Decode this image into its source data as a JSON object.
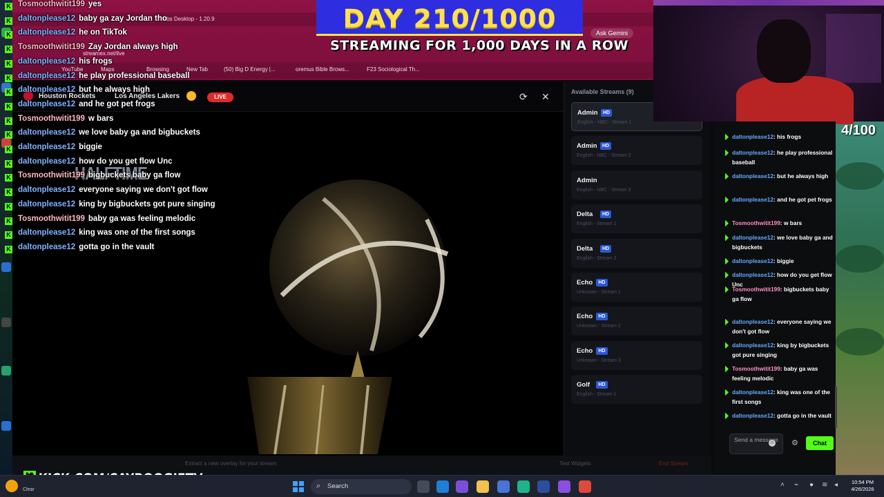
{
  "browser": {
    "app_title": "labs Desktop - 1.20.9",
    "address": "streamex.net/live",
    "ask_gemini": "Ask Gemini",
    "bookmarks": [
      "YouTube",
      "Maps",
      "Browsing",
      "New Tab",
      "(50) Big D Energy |...",
      "oremus Bible Brows...",
      "F23 Sociological Th..."
    ]
  },
  "banner": {
    "day": "DAY 210/1000",
    "subtitle": "STREAMING FOR 1,000 DAYS IN A ROW"
  },
  "counter": "4/100",
  "player": {
    "home_team": "Houston Rockets",
    "away_team": "Los Angeles Lakers",
    "live": "LIVE",
    "refresh_icon": "refresh-icon",
    "close_icon": "close-icon",
    "halftime": "HALFTIME"
  },
  "overlay_chat": [
    {
      "user": "Tosmoothwitit199",
      "msg": "yes",
      "type": "t"
    },
    {
      "user": "daltonplease12",
      "msg": "baby ga zay Jordan tho",
      "type": "d"
    },
    {
      "user": "daltonplease12",
      "msg": "he on TikTok",
      "type": "d"
    },
    {
      "user": "Tosmoothwitit199",
      "msg": "Zay Jordan always high",
      "type": "t"
    },
    {
      "user": "daltonplease12",
      "msg": "his frogs",
      "type": "d"
    },
    {
      "user": "daltonplease12",
      "msg": "he play professional baseball",
      "type": "d"
    },
    {
      "user": "daltonplease12",
      "msg": "but he always high",
      "type": "d"
    },
    {
      "user": "daltonplease12",
      "msg": "and he got pet frogs",
      "type": "d"
    },
    {
      "user": "Tosmoothwitit199",
      "msg": "w bars",
      "type": "t"
    },
    {
      "user": "daltonplease12",
      "msg": "we love baby ga and bigbuckets",
      "type": "d"
    },
    {
      "user": "daltonplease12",
      "msg": "biggie",
      "type": "d"
    },
    {
      "user": "daltonplease12",
      "msg": "how do you get flow Unc",
      "type": "d"
    },
    {
      "user": "Tosmoothwitit199",
      "msg": "bigbuckets baby ga flow",
      "type": "t"
    },
    {
      "user": "daltonplease12",
      "msg": "everyone saying we don't got flow",
      "type": "d"
    },
    {
      "user": "daltonplease12",
      "msg": "king by bigbuckets got pure singing",
      "type": "d"
    },
    {
      "user": "Tosmoothwitit199",
      "msg": "baby ga was feeling melodic",
      "type": "t"
    },
    {
      "user": "daltonplease12",
      "msg": "king was one of the first songs",
      "type": "d"
    },
    {
      "user": "daltonplease12",
      "msg": "gotta go in the vault",
      "type": "d"
    }
  ],
  "streams": {
    "header": "Available Streams (9)",
    "items": [
      {
        "name": "Admin",
        "hd": "HD",
        "sub": "English - NBC - Stream 1"
      },
      {
        "name": "Admin",
        "hd": "HD",
        "sub": "English - NBC - Stream 2"
      },
      {
        "name": "Admin",
        "hd": "",
        "sub": "English - NBC - Stream 3"
      },
      {
        "name": "Delta",
        "hd": "HD",
        "sub": "English - Stream 1"
      },
      {
        "name": "Delta",
        "hd": "HD",
        "sub": "English - Stream 2"
      },
      {
        "name": "Echo",
        "hd": "HD",
        "sub": "Unknown - Stream 1"
      },
      {
        "name": "Echo",
        "hd": "HD",
        "sub": "Unknown - Stream 2"
      },
      {
        "name": "Echo",
        "hd": "HD",
        "sub": "Unknown - Stream 3"
      },
      {
        "name": "Golf",
        "hd": "HD",
        "sub": "English - Stream 1"
      }
    ]
  },
  "kick_chat": {
    "messages": [
      {
        "user": "daltonplease12",
        "msg": "his frogs",
        "type": "d"
      },
      {
        "user": "daltonplease12",
        "msg": "he play professional baseball",
        "type": "d"
      },
      {
        "user": "daltonplease12",
        "msg": "but he always high",
        "type": "d"
      },
      {
        "user": "daltonplease12",
        "msg": "and he got pet frogs",
        "type": "d"
      },
      {
        "user": "Tosmoothwitit199",
        "msg": "w bars",
        "type": "t"
      },
      {
        "user": "daltonplease12",
        "msg": "we love baby ga and bigbuckets",
        "type": "d"
      },
      {
        "user": "daltonplease12",
        "msg": "biggie",
        "type": "d"
      },
      {
        "user": "daltonplease12",
        "msg": "how do you get flow Unc",
        "type": "d"
      },
      {
        "user": "Tosmoothwitit199",
        "msg": "bigbuckets baby ga flow",
        "type": "t"
      },
      {
        "user": "daltonplease12",
        "msg": "everyone saying we don't got flow",
        "type": "d"
      },
      {
        "user": "daltonplease12",
        "msg": "king by bigbuckets got pure singing",
        "type": "d"
      },
      {
        "user": "Tosmoothwitit199",
        "msg": "baby ga was feeling melodic",
        "type": "t"
      },
      {
        "user": "daltonplease12",
        "msg": "king was one of the first songs",
        "type": "d"
      },
      {
        "user": "daltonplease12",
        "msg": "gotta go in the vault",
        "type": "d"
      }
    ],
    "input_placeholder": "Send a message",
    "chat_button": "Chat"
  },
  "under_player": {
    "left_text": "Extract a new overlay for your stream",
    "middle_text": "Test Widgets",
    "right_text": "End Stream"
  },
  "footer": {
    "kick_url": "KICK.COM/CAYBOOGIETV"
  },
  "taskbar": {
    "weather": "Clear",
    "search": "Search",
    "time": "10:54 PM",
    "date": "4/26/2026"
  },
  "colors": {
    "kick_green": "#53fc18",
    "banner_yellow": "#ffe14f",
    "banner_blue": "#2e2de0",
    "live_red": "#e12b2b",
    "browser_magenta": "#8e1244"
  }
}
